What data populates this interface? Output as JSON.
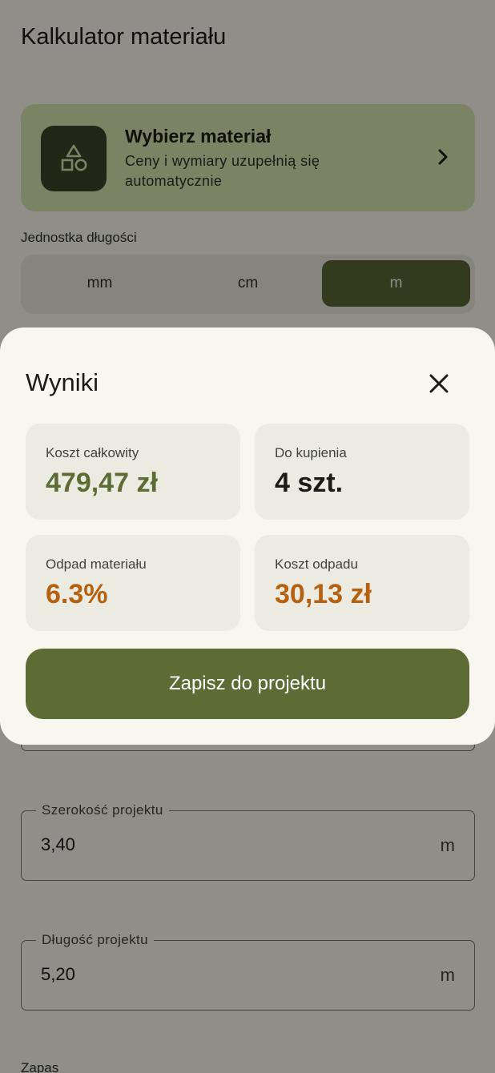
{
  "app": {
    "title": "Kalkulator materiału"
  },
  "material": {
    "icon": "shapes-icon",
    "title": "Wybierz materiał",
    "subtitle": "Ceny i wymiary uzupełnią się automatycznie"
  },
  "units": {
    "label": "Jednostka długości",
    "options": [
      "mm",
      "cm",
      "m"
    ],
    "selected": "m"
  },
  "fields": {
    "width": {
      "label": "Szerokość projektu",
      "value": "3,40",
      "unit": "m"
    },
    "length": {
      "label": "Długość projektu",
      "value": "5,20",
      "unit": "m"
    },
    "reserve_label": "Zapas"
  },
  "results": {
    "title": "Wyniki",
    "total_cost": {
      "label": "Koszt całkowity",
      "value": "479,47 zł"
    },
    "to_buy": {
      "label": "Do kupienia",
      "value": "4 szt."
    },
    "waste": {
      "label": "Odpad materiału",
      "value": "6.3%"
    },
    "waste_cost": {
      "label": "Koszt odpadu",
      "value": "30,13 zł"
    },
    "save_label": "Zapisz do projektu"
  },
  "colors": {
    "accent_green": "#5d6b34",
    "warning_orange": "#b5610f"
  }
}
